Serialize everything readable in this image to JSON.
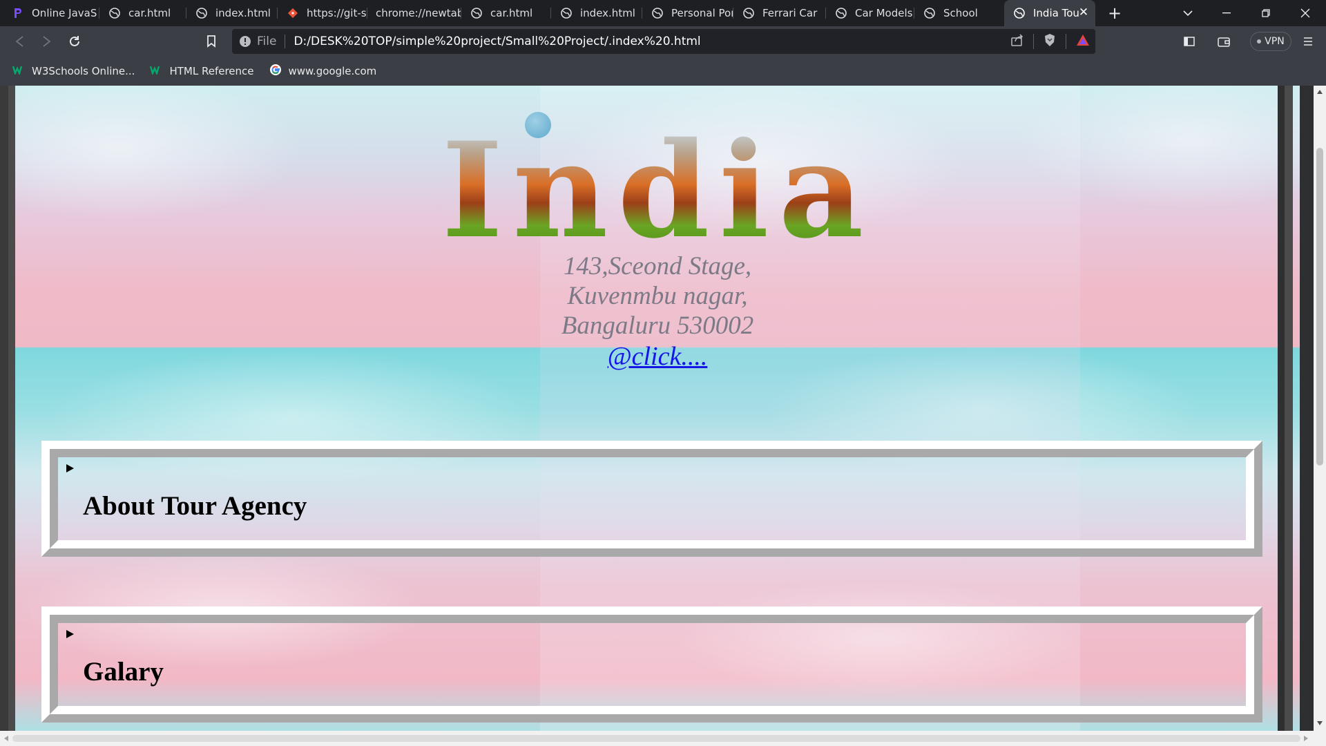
{
  "browser": {
    "tabs": [
      {
        "title": "Online JavaS",
        "active": false
      },
      {
        "title": "car.html",
        "active": false
      },
      {
        "title": "index.html",
        "active": false
      },
      {
        "title": "https://git-sc",
        "active": false
      },
      {
        "title": "chrome://newtab",
        "active": false
      },
      {
        "title": "car.html",
        "active": false
      },
      {
        "title": "index.html",
        "active": false
      },
      {
        "title": "Personal Port",
        "active": false
      },
      {
        "title": "Ferrari Car",
        "active": false
      },
      {
        "title": "Car Models",
        "active": false
      },
      {
        "title": "School",
        "active": false
      },
      {
        "title": "India Tou",
        "active": true
      }
    ],
    "new_tab_symbol": "+",
    "address": {
      "scheme": "File",
      "url": "D:/DESK%20TOP/simple%20project/Small%20Project/.index%20.html"
    },
    "vpn_label": "VPN",
    "bookmarks": [
      {
        "label": "W3Schools Online...",
        "icon": "w3schools-icon"
      },
      {
        "label": "HTML Reference",
        "icon": "w3schools-icon"
      },
      {
        "label": "www.google.com",
        "icon": "google-icon"
      }
    ]
  },
  "page": {
    "title": "India Tour",
    "address_lines": [
      "143,Sceond Stage,",
      "Kuvenmbu nagar,",
      "Bangaluru 530002"
    ],
    "link_text": "@click....",
    "sections": [
      {
        "heading": "About Tour Agency"
      },
      {
        "heading": "Galary"
      }
    ]
  },
  "colors": {
    "link": "#1515e6",
    "address_text": "#7c7a86",
    "tab_bar": "#1d1f23",
    "toolbar": "#3b3e44"
  }
}
